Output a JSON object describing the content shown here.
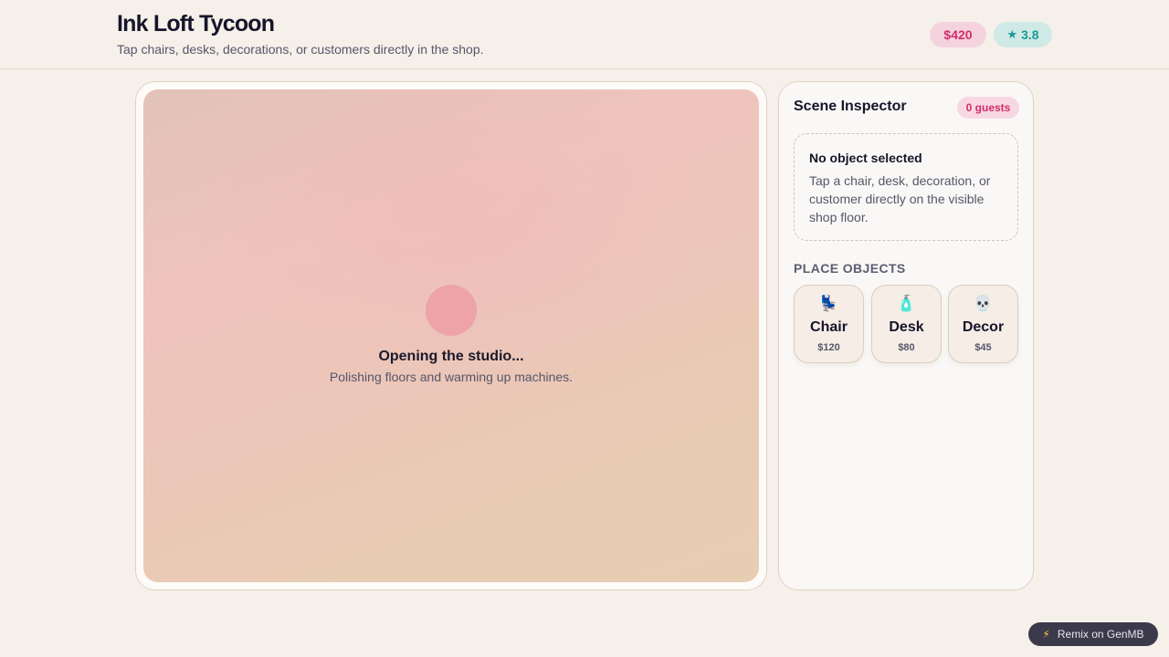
{
  "header": {
    "title": "Ink Loft Tycoon",
    "subtitle": "Tap chairs, desks, decorations, or customers directly in the shop.",
    "money": "$420",
    "rating_icon": "★",
    "rating": "3.8"
  },
  "stage": {
    "loading_title": "Opening the studio...",
    "loading_subtitle": "Polishing floors and warming up machines."
  },
  "inspector": {
    "title": "Scene Inspector",
    "guests": "0 guests",
    "empty_title": "No object selected",
    "empty_text": "Tap a chair, desk, decoration, or customer directly on the visible shop floor.",
    "place_label": "PLACE OBJECTS",
    "objects": [
      {
        "icon": "💺",
        "icon_name": "chair-icon",
        "name": "Chair",
        "price": "$120"
      },
      {
        "icon": "🧴",
        "icon_name": "desk-icon",
        "name": "Desk",
        "price": "$80"
      },
      {
        "icon": "💀",
        "icon_name": "skull-icon",
        "name": "Decor",
        "price": "$45"
      }
    ]
  },
  "footer": {
    "remix_icon": "⚡",
    "remix_label": "Remix on GenMB"
  },
  "colors": {
    "accent_pink": "#d22e6a",
    "accent_teal": "#1a9a93",
    "background": "#f6f0ea"
  }
}
